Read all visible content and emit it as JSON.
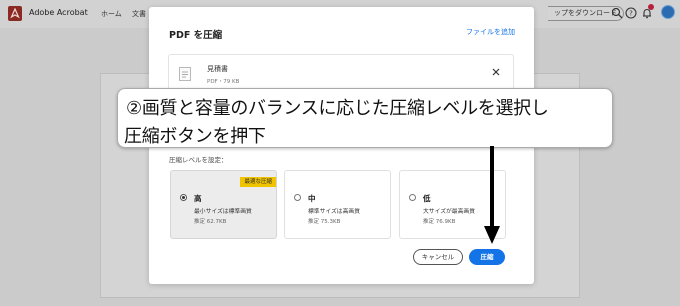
{
  "app": {
    "title": "Adobe Acrobat",
    "nav": {
      "home": "ホーム",
      "docs": "文書"
    },
    "download_label": "ップをダウンロード",
    "notification_count": "1"
  },
  "dialog": {
    "title": "PDF を圧縮",
    "add_file": "ファイルを追加",
    "file": {
      "name": "見積書",
      "meta": "PDF・79 KB"
    },
    "level_label": "圧縮レベルを設定：",
    "options": [
      {
        "name": "高",
        "desc": "最小サイズは標準画質",
        "estimate": "推定 62.7KB",
        "badge": "最適な圧縮",
        "selected": true
      },
      {
        "name": "中",
        "desc": "標準サイズは高画質",
        "estimate": "推定 75.3KB",
        "selected": false
      },
      {
        "name": "低",
        "desc": "大サイズが最高画質",
        "estimate": "推定 76.9KB",
        "selected": false
      }
    ],
    "cancel_label": "キャンセル",
    "compress_label": "圧縮"
  },
  "annotation": {
    "line1": "②画質と容量のバランスに応じた圧縮レベルを選択し",
    "line2": "圧縮ボタンを押下"
  },
  "colors": {
    "accent": "#1473e6",
    "badge": "#f0c400",
    "acrobat_red": "#8a2a22"
  }
}
